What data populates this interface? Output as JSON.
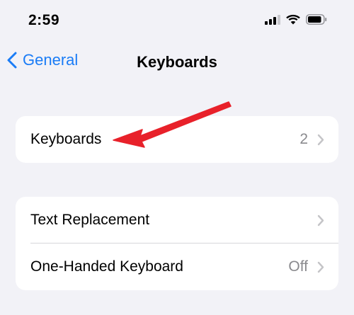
{
  "status_bar": {
    "time": "2:59",
    "icons": [
      "cellular-signal-icon",
      "wifi-icon",
      "battery-icon"
    ]
  },
  "nav": {
    "back_label": "General",
    "title": "Keyboards"
  },
  "groups": [
    {
      "rows": [
        {
          "label": "Keyboards",
          "value": "2"
        }
      ]
    },
    {
      "rows": [
        {
          "label": "Text Replacement",
          "value": ""
        },
        {
          "label": "One-Handed Keyboard",
          "value": "Off"
        }
      ]
    }
  ],
  "annotation": {
    "icon": "red-arrow-icon",
    "color": "#e8212a"
  },
  "colors": {
    "background": "#f2f2f7",
    "accent": "#1a7cf6",
    "secondary_text": "#8a8a8e"
  }
}
